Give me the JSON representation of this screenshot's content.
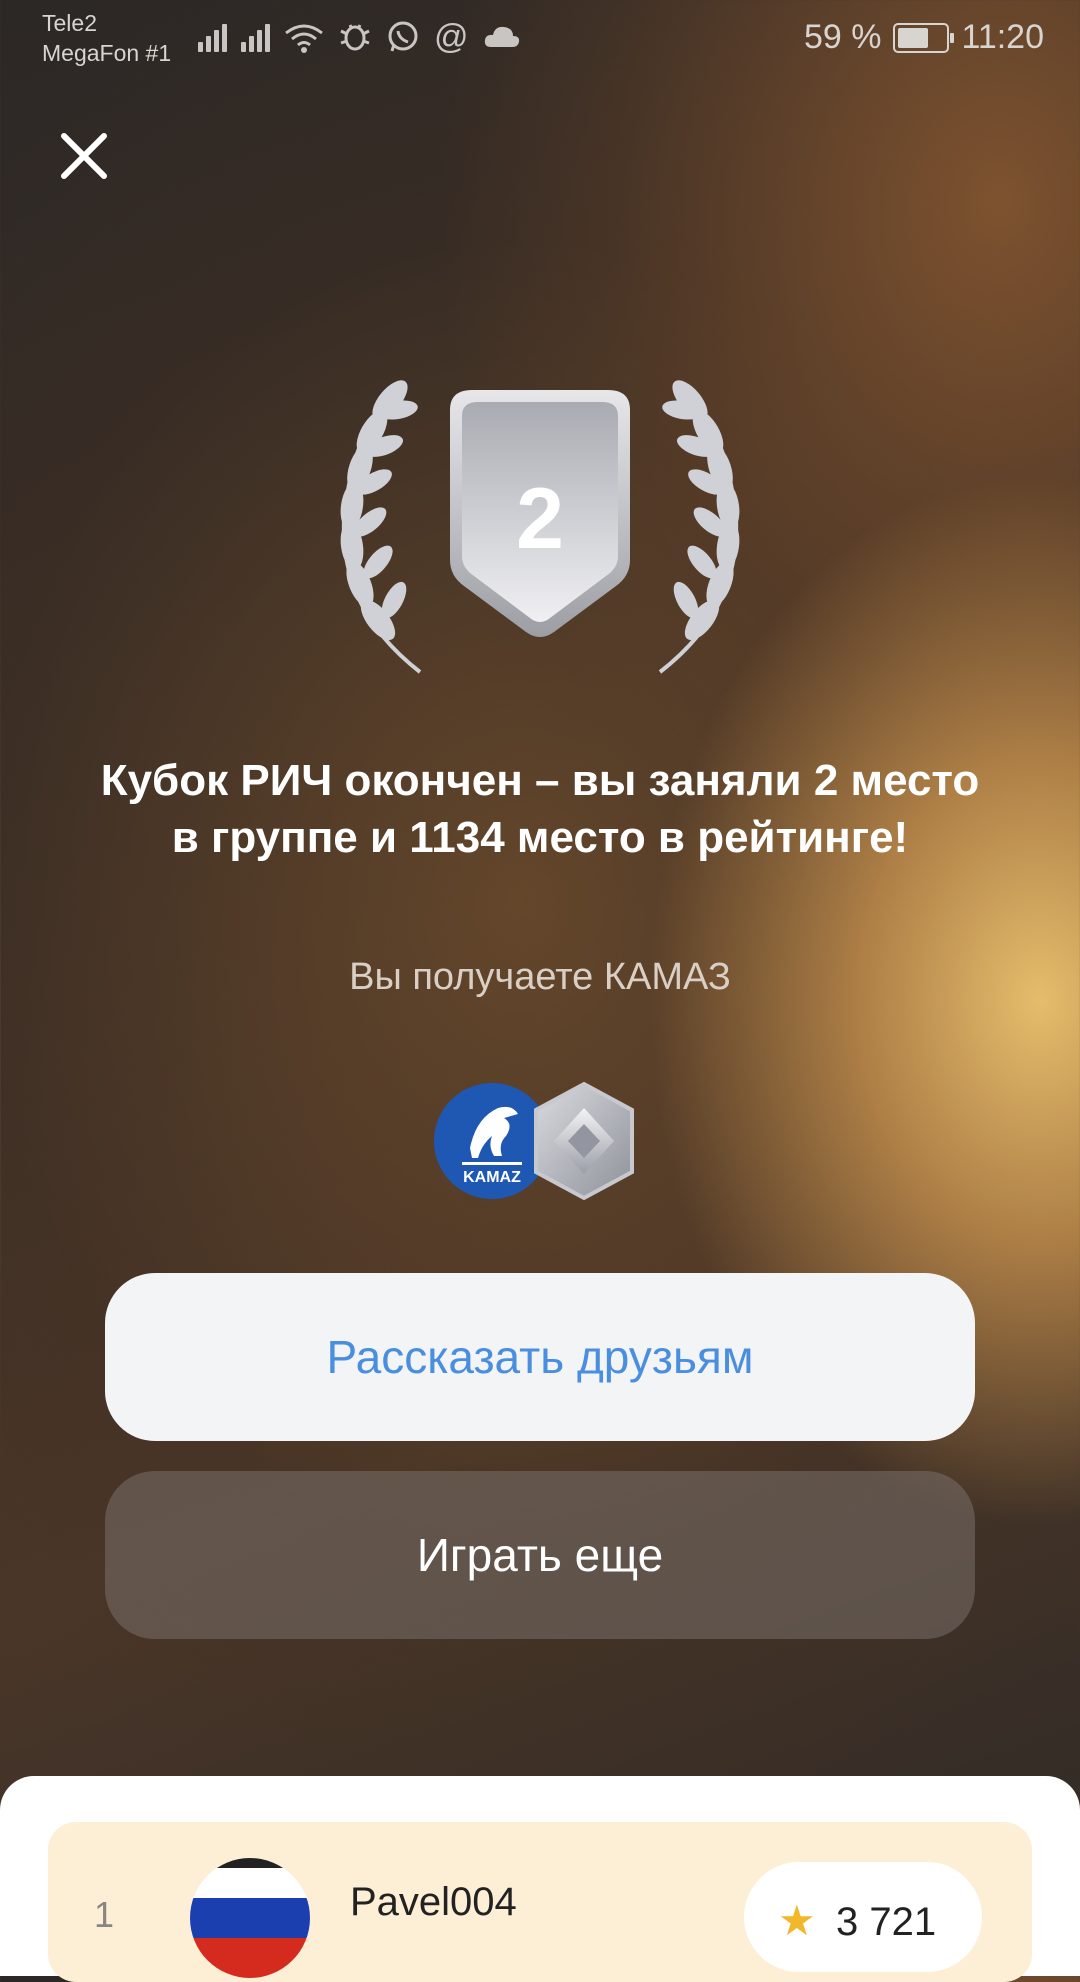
{
  "status_bar": {
    "carrier_1": "Tele2",
    "carrier_2": "MegaFon #1",
    "battery": "59 %",
    "time": "11:20",
    "icons": [
      "signal-icon",
      "signal-icon",
      "wifi-icon",
      "bug-icon",
      "whatsapp-icon",
      "at-icon",
      "cloud-icon"
    ]
  },
  "result": {
    "place_number": "2",
    "headline": "Кубок РИЧ окончен – вы заняли 2 место в группе и 1134 место в рейтинге!",
    "reward_text": "Вы получаете КАМАЗ",
    "reward_logo_text": "KAMAZ"
  },
  "buttons": {
    "share_label": "Рассказать друзьям",
    "play_label": "Играть еще"
  },
  "leaderboard": {
    "rows": [
      {
        "rank": "1",
        "name": "Pavel004",
        "score": "3 721"
      }
    ]
  },
  "colors": {
    "share_text": "#4a8ee0",
    "star": "#f2b82b",
    "row_background": "#fcefd6"
  }
}
